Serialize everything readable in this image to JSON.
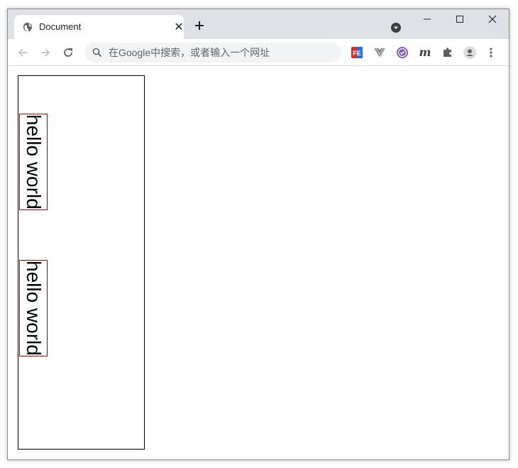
{
  "browser": {
    "tab": {
      "title": "Document",
      "favicon": "globe-icon",
      "close": "✕"
    },
    "new_tab_icon": "plus-icon",
    "tab_search_icon": "chevron-down-circle-icon",
    "window_controls": [
      "minimize-icon",
      "maximize-icon",
      "close-icon"
    ],
    "nav": [
      "back-icon",
      "forward-icon",
      "reload-icon"
    ],
    "omnibox": {
      "placeholder": "在Google中搜索，或者输入一个网址",
      "icon": "search-icon"
    },
    "extensions": [
      {
        "name": "fe-helper-icon",
        "label": "FE"
      },
      {
        "name": "vue-devtools-icon"
      },
      {
        "name": "checkmark-badge-icon"
      },
      {
        "name": "m-extension-icon",
        "label": "m"
      },
      {
        "name": "puzzle-icon"
      },
      {
        "name": "profile-avatar-icon"
      },
      {
        "name": "more-menu-icon"
      }
    ],
    "colors": {
      "titlebar": "#dee1e6",
      "omnibox_bg": "#f1f3f4",
      "box_border": "#c00000"
    }
  },
  "page": {
    "texts": [
      "hello world",
      "hello world"
    ]
  }
}
